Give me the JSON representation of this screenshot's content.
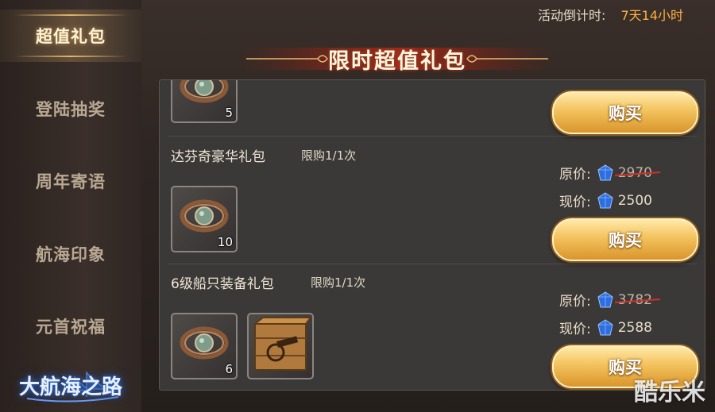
{
  "sidebar": {
    "items": [
      {
        "label": "超值礼包",
        "active": true
      },
      {
        "label": "登陆抽奖",
        "active": false
      },
      {
        "label": "周年寄语",
        "active": false
      },
      {
        "label": "航海印象",
        "active": false
      },
      {
        "label": "元首祝福",
        "active": false
      }
    ],
    "logo": "大航海之路"
  },
  "countdown": {
    "label": "活动倒计时:",
    "value": "7天14小时"
  },
  "banner": {
    "title": "限时超值礼包"
  },
  "packs": [
    {
      "items": [
        {
          "icon": "ring-item-icon",
          "count": "5"
        }
      ],
      "buy_label": "购买"
    },
    {
      "name": "达芬奇豪华礼包",
      "limit": "限购1/1次",
      "original_label": "原价:",
      "original_price": "2970",
      "current_label": "现价:",
      "current_price": "2500",
      "items": [
        {
          "icon": "ring-item-icon",
          "count": "10"
        }
      ],
      "buy_label": "购买"
    },
    {
      "name": "6级船只装备礼包",
      "limit": "限购1/1次",
      "original_label": "原价:",
      "original_price": "3782",
      "current_label": "现价:",
      "current_price": "2588",
      "items": [
        {
          "icon": "ring-item-icon",
          "count": "6"
        },
        {
          "icon": "cannon-crate-icon",
          "count": ""
        }
      ],
      "buy_label": "购买"
    }
  ],
  "currency_icon": "blue-gem-icon",
  "watermark": "酷乐米",
  "colors": {
    "countdown_value": "#ffb040",
    "button_gold": "#f3c25d",
    "strike_red": "#d0302a"
  }
}
